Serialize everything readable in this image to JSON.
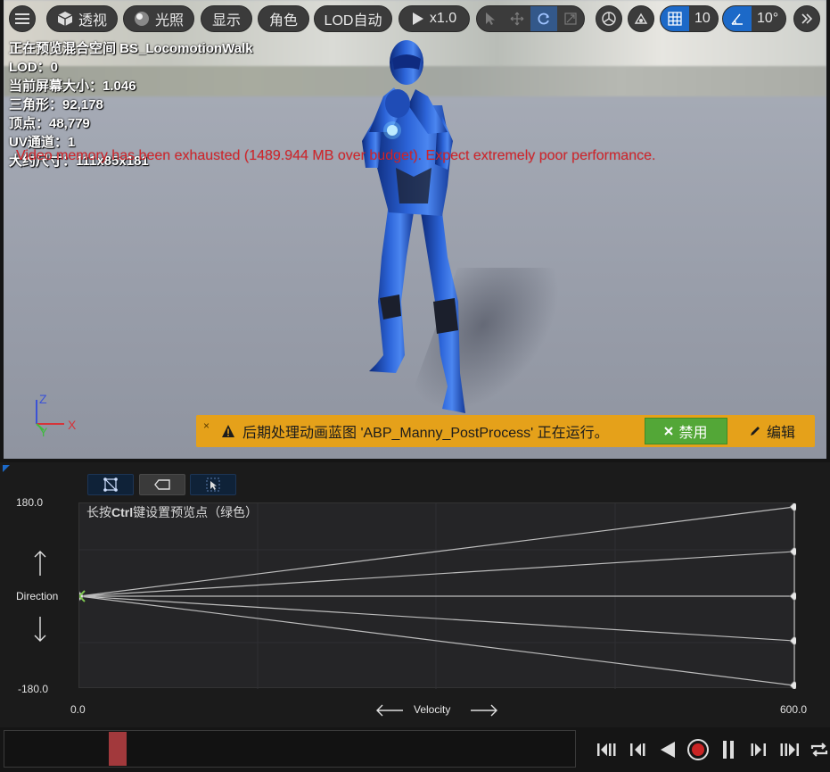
{
  "toolbar": {
    "menu_icon": "hamburger-icon",
    "perspective_label": "透视",
    "lighting_label": "光照",
    "show_label": "显示",
    "character_label": "角色",
    "lod_label": "LOD自动",
    "play_speed_label": "x1.0",
    "grid_snap_value": "10",
    "angle_snap_value": "10°",
    "transform_tools": [
      "select-arrow-icon",
      "move-icon",
      "rotate-icon",
      "scale-icon"
    ]
  },
  "stats": {
    "preview_line": "正在预览混合空间 BS_LocomotionWalk",
    "lod_line": "LOD：0",
    "screen_size_line": "当前屏幕大小：1.046",
    "triangles_line": "三角形：92,178",
    "vertices_line": "顶点：48,779",
    "uv_line": "UV通道：1",
    "approx_size_line": "大约尺寸：111x85x181"
  },
  "warning_text": "Video memory has been exhausted (1489.944 MB over budget). Expect extremely poor performance.",
  "gizmo": {
    "z": "Z",
    "y": "Y",
    "x": "X"
  },
  "notice": {
    "close_label": "×",
    "message": "后期处理动画蓝图 'ABP_Manny_PostProcess' 正在运行。",
    "disable_label": "禁用",
    "edit_label": "编辑"
  },
  "blend_space": {
    "hint_prefix": "长按",
    "hint_key": "Ctrl",
    "hint_suffix": "键设置预览点（绿色）",
    "y_axis_name": "Direction",
    "y_max": "180.0",
    "y_min": "-180.0",
    "x_axis_name": "Velocity",
    "x_min": "0.0",
    "x_max": "600.0",
    "samples": [
      {
        "velocity": 600,
        "direction": 180
      },
      {
        "velocity": 600,
        "direction": 90
      },
      {
        "velocity": 600,
        "direction": 0
      },
      {
        "velocity": 600,
        "direction": -90
      },
      {
        "velocity": 600,
        "direction": -180
      }
    ],
    "origin_sample": {
      "velocity": 0,
      "direction": 0
    },
    "colors": {
      "accent_blue": "#1c69c8",
      "preview_green": "#7ec850",
      "notice_yellow": "#e5a11a",
      "disable_green": "#53a737",
      "warning_red": "#d3242a",
      "scrub_red": "#a2393c"
    }
  },
  "transport": [
    "skip-to-start-icon",
    "step-back-icon",
    "play-reverse-icon",
    "record-icon",
    "pause-icon",
    "step-forward-icon",
    "skip-to-end-icon",
    "loop-icon"
  ]
}
